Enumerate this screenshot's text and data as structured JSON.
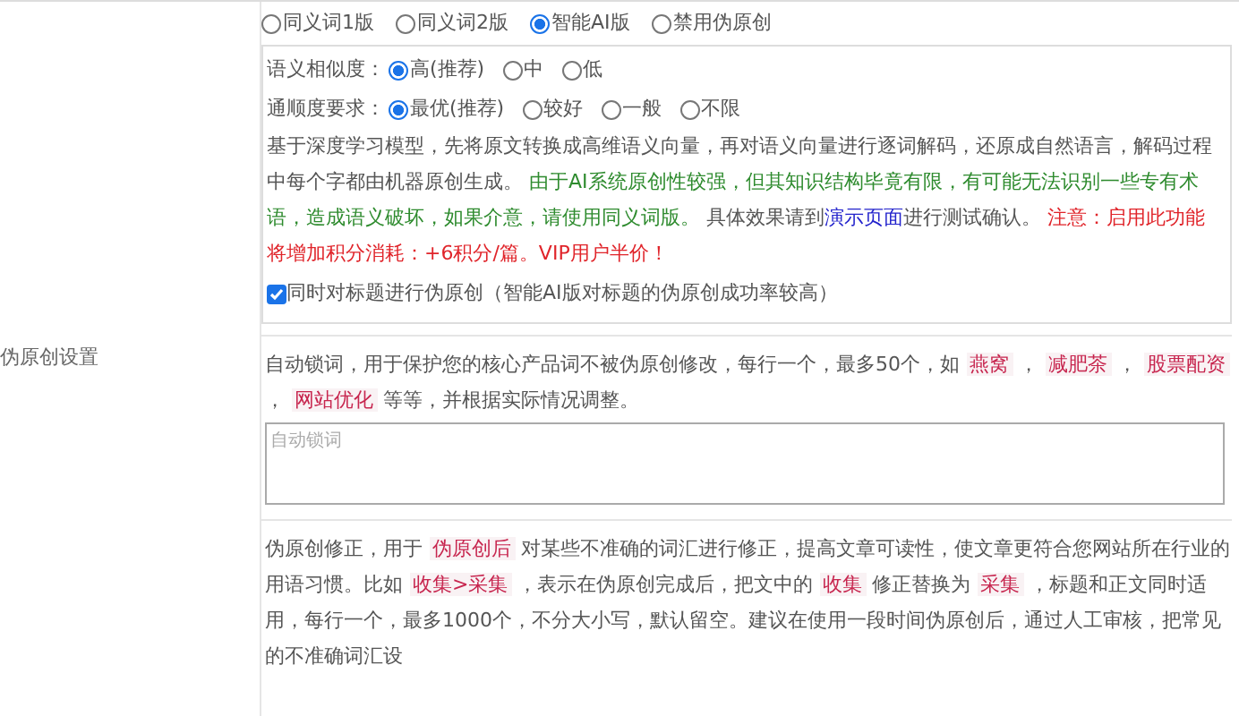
{
  "label": "伪原创设置",
  "versions": [
    {
      "label": "同义词1版",
      "selected": false
    },
    {
      "label": "同义词2版",
      "selected": false
    },
    {
      "label": "智能AI版",
      "selected": true
    },
    {
      "label": "禁用伪原创",
      "selected": false
    }
  ],
  "similarity": {
    "label": "语义相似度：",
    "options": [
      {
        "label": "高(推荐)",
        "selected": true
      },
      {
        "label": "中",
        "selected": false
      },
      {
        "label": "低",
        "selected": false
      }
    ]
  },
  "fluency": {
    "label": "通顺度要求：",
    "options": [
      {
        "label": "最优(推荐)",
        "selected": true
      },
      {
        "label": "较好",
        "selected": false
      },
      {
        "label": "一般",
        "selected": false
      },
      {
        "label": "不限",
        "selected": false
      }
    ]
  },
  "description": [
    {
      "kind": "plain",
      "text": "基于深度学习模型，先将原文转换成高维语义向量，再对语义向量进行逐词解码，还原成自然语言，解码过程中每个字都由机器原创生成。 "
    },
    {
      "kind": "green",
      "text": "由于AI系统原创性较强，但其知识结构毕竟有限，有可能无法识别一些专有术语，造成语义破坏，如果介意，请使用同义词版。"
    },
    {
      "kind": "plain",
      "text": " 具体效果请到"
    },
    {
      "kind": "link",
      "text": "演示页面"
    },
    {
      "kind": "plain",
      "text": "进行测试确认。 "
    },
    {
      "kind": "red",
      "text": "注意：启用此功能将增加积分消耗：+6积分/篇。VIP用户半价！"
    }
  ],
  "title_checkbox": {
    "label": "同时对标题进行伪原创（智能AI版对标题的伪原创成功率较高）",
    "checked": true
  },
  "lock_words": {
    "text": [
      {
        "kind": "plain",
        "text": "自动锁词，用于保护您的核心产品词不被伪原创修改，每行一个，最多50个，如 "
      },
      {
        "kind": "code",
        "text": "燕窝"
      },
      {
        "kind": "plain",
        "text": " ， "
      },
      {
        "kind": "code",
        "text": "减肥茶"
      },
      {
        "kind": "plain",
        "text": " ， "
      },
      {
        "kind": "code",
        "text": "股票配资"
      },
      {
        "kind": "plain",
        "text": " ， "
      },
      {
        "kind": "code",
        "text": "网站优化"
      },
      {
        "kind": "plain",
        "text": " 等等，并根据实际情况调整。"
      }
    ],
    "placeholder": "自动锁词"
  },
  "correction": [
    {
      "kind": "plain",
      "text": "伪原创修正，用于 "
    },
    {
      "kind": "code",
      "text": "伪原创后"
    },
    {
      "kind": "plain",
      "text": " 对某些不准确的词汇进行修正，提高文章可读性，使文章更符合您网站所在行业的用语习惯。比如 "
    },
    {
      "kind": "code",
      "text": "收集>采集"
    },
    {
      "kind": "plain",
      "text": " ，表示在伪原创完成后，把文中的 "
    },
    {
      "kind": "code",
      "text": "收集"
    },
    {
      "kind": "plain",
      "text": " 修正替换为 "
    },
    {
      "kind": "code",
      "text": "采集"
    },
    {
      "kind": "plain",
      "text": " ，标题和正文同时适用，每行一个，最多1000个，不分大小写，默认留空。建议在使用一段时间伪原创后，通过人工审核，把常见的不准确词汇设"
    }
  ]
}
